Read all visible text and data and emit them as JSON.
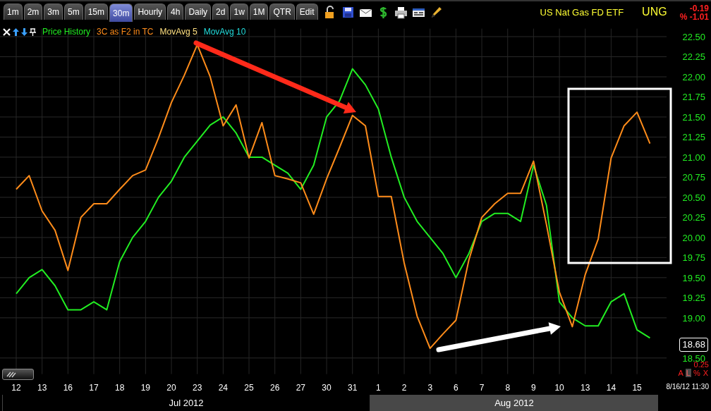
{
  "toolbar": {
    "tabs": [
      {
        "label": "1m",
        "selected": false
      },
      {
        "label": "2m",
        "selected": false
      },
      {
        "label": "3m",
        "selected": false
      },
      {
        "label": "5m",
        "selected": false
      },
      {
        "label": "15m",
        "selected": false
      },
      {
        "label": "30m",
        "selected": true
      },
      {
        "label": "Hourly",
        "selected": false
      },
      {
        "label": "4h",
        "selected": false
      },
      {
        "label": "Daily",
        "selected": false
      },
      {
        "label": "2d",
        "selected": false
      },
      {
        "label": "1w",
        "selected": false
      },
      {
        "label": "1M",
        "selected": false
      },
      {
        "label": "QTR",
        "selected": false
      },
      {
        "label": "Edit",
        "selected": false
      }
    ],
    "tools": [
      {
        "kind": "lock"
      },
      {
        "kind": "save"
      },
      {
        "kind": "mail"
      },
      {
        "kind": "dollar"
      },
      {
        "kind": "print"
      },
      {
        "kind": "window"
      },
      {
        "kind": "pencil"
      }
    ]
  },
  "quote": {
    "name": "US Nat Gas FD ETF",
    "symbol": "UNG",
    "change": "-0.19",
    "percent_change": "% -1.01"
  },
  "legend_extra": [
    {
      "label": "MovAvg 5",
      "color": "#ffe080"
    },
    {
      "label": "MovAvg 10",
      "color": "#22dddd"
    }
  ],
  "chart": {
    "chart_data": {
      "type": "line",
      "grid": true,
      "categories": [
        "12",
        null,
        "13",
        null,
        "16",
        null,
        "17",
        null,
        "18",
        null,
        "19",
        null,
        "20",
        null,
        "23",
        null,
        "24",
        null,
        "25",
        null,
        "26",
        null,
        "27",
        null,
        "30",
        null,
        "31",
        null,
        "1",
        null,
        "2",
        null,
        "3",
        null,
        "6",
        null,
        "7",
        null,
        "8",
        null,
        "9",
        null,
        "10",
        null,
        "13",
        null,
        "14",
        null,
        "15",
        null
      ],
      "ylim": [
        18.3,
        22.6
      ],
      "series": [
        {
          "name": "Price History",
          "color": "#22ee22",
          "values": [
            19.3,
            19.5,
            19.6,
            19.4,
            19.1,
            19.1,
            19.2,
            19.1,
            19.7,
            20.0,
            20.2,
            20.5,
            20.7,
            21.0,
            21.2,
            21.4,
            21.5,
            21.3,
            21.0,
            21.0,
            20.9,
            20.8,
            20.6,
            20.9,
            21.5,
            21.7,
            22.1,
            21.9,
            21.6,
            21.0,
            20.5,
            20.2,
            20.0,
            19.8,
            19.5,
            19.8,
            20.2,
            20.3,
            20.3,
            20.2,
            20.9,
            20.4,
            19.2,
            19.0,
            18.9,
            18.9,
            19.2,
            19.3,
            18.85,
            18.75
          ]
        },
        {
          "name": "3C as F2 in TC",
          "color": "#ff8c1a",
          "values": [
            20.6,
            20.77,
            20.33,
            20.09,
            19.59,
            20.25,
            20.42,
            20.42,
            20.6,
            20.77,
            20.84,
            21.24,
            21.68,
            22.02,
            22.4,
            22.0,
            21.39,
            21.65,
            20.99,
            21.43,
            20.77,
            20.73,
            20.68,
            20.29,
            20.73,
            21.12,
            21.52,
            21.39,
            20.51,
            20.51,
            19.68,
            19.02,
            18.62,
            18.8,
            18.97,
            19.72,
            20.25,
            20.42,
            20.55,
            20.55,
            20.95,
            20.16,
            19.32,
            18.89,
            19.54,
            19.98,
            20.99,
            21.39,
            21.56,
            21.17
          ]
        }
      ],
      "yticks": [
        {
          "value": 18.5,
          "label": "18.50"
        },
        {
          "value": 19,
          "label": "19.00"
        },
        {
          "value": 19.25,
          "label": "19.25"
        },
        {
          "value": 19.5,
          "label": "19.50"
        },
        {
          "value": 19.75,
          "label": "19.75"
        },
        {
          "value": 20,
          "label": "20.00"
        },
        {
          "value": 20.25,
          "label": "20.25"
        },
        {
          "value": 20.5,
          "label": "20.50"
        },
        {
          "value": 20.75,
          "label": "20.75"
        },
        {
          "value": 21,
          "label": "21.00"
        },
        {
          "value": 21.25,
          "label": "21.25"
        },
        {
          "value": 21.5,
          "label": "21.50"
        },
        {
          "value": 21.75,
          "label": "21.75"
        },
        {
          "value": 22,
          "label": "22.00"
        },
        {
          "value": 22.25,
          "label": "22.25"
        },
        {
          "value": 22.5,
          "label": "22.50"
        }
      ]
    },
    "markups": [
      {
        "kind": "arrow",
        "color": "#ff2a1a"
      },
      {
        "kind": "arrow",
        "color": "#ffffff"
      },
      {
        "kind": "box",
        "color": "#ffffff"
      }
    ],
    "last_price": "18.68",
    "scale_value": "0.25",
    "scale_toggles": [
      {
        "label": "A",
        "selected": false
      },
      {
        "label": "L",
        "selected": true
      },
      {
        "label": "%",
        "selected": false
      },
      {
        "label": "X",
        "selected": false
      }
    ],
    "timestamp": "8/16/12 11:30"
  },
  "months": [
    {
      "label": "Jul 2012",
      "selected": false
    },
    {
      "label": "Aug 2012",
      "selected": true
    }
  ]
}
